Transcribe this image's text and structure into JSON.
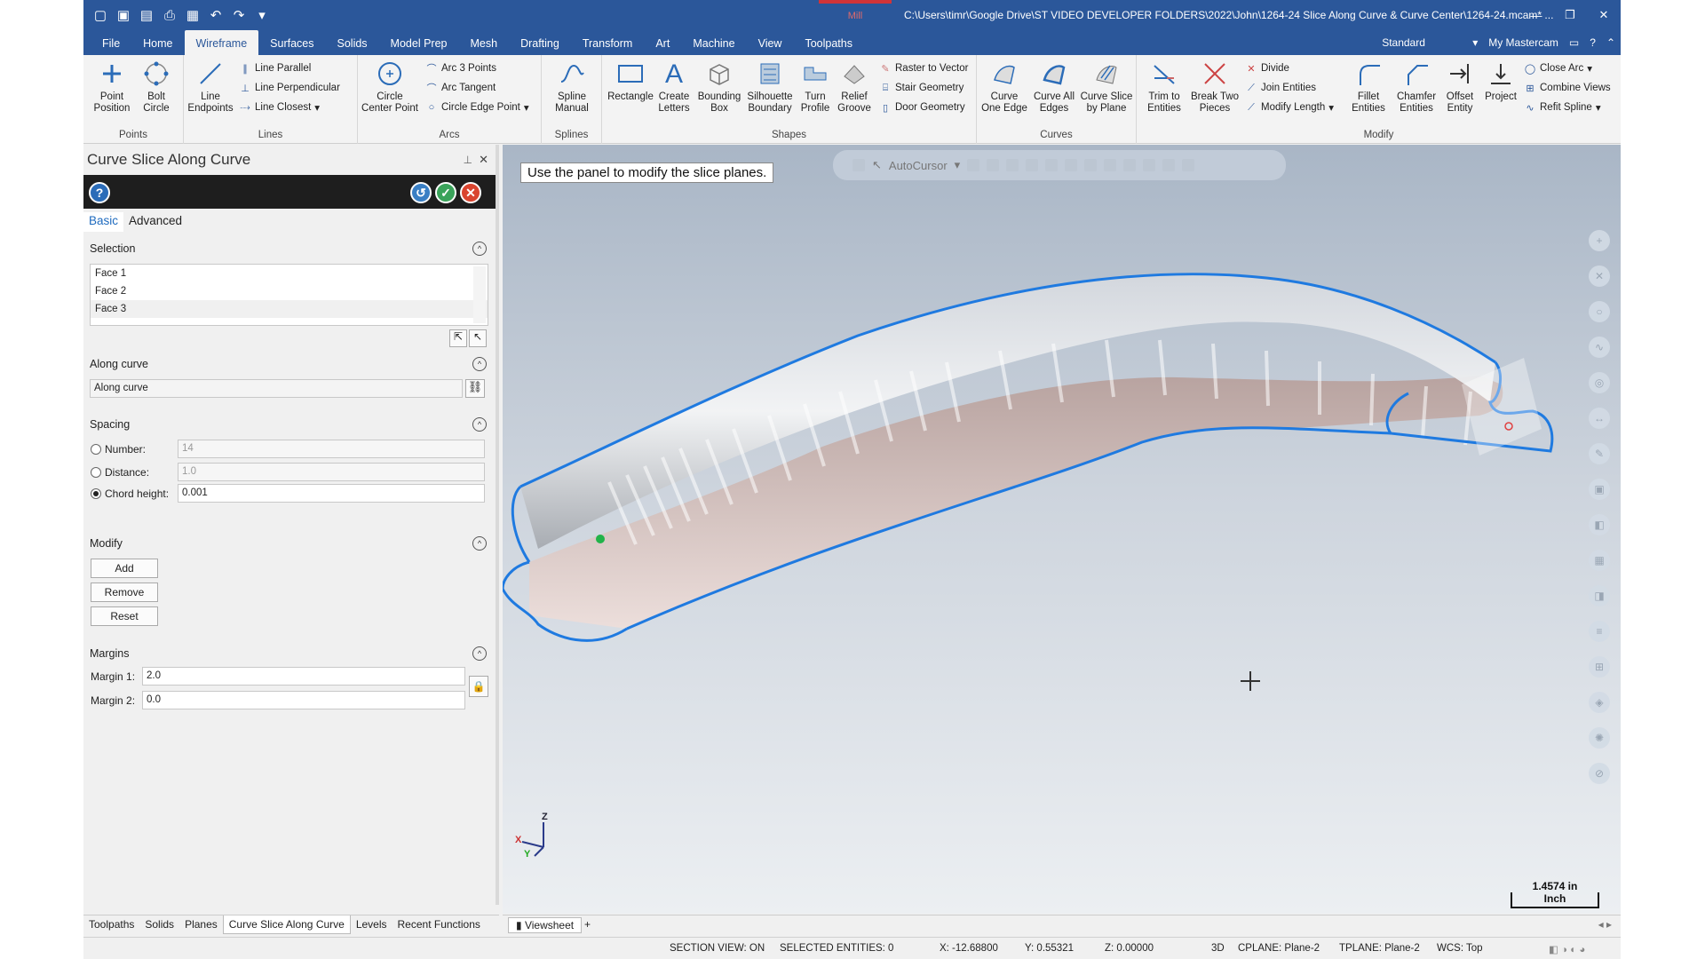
{
  "titlebar": {
    "context_tab": "Mill",
    "title": "C:\\Users\\timr\\Google Drive\\ST VIDEO DEVELOPER FOLDERS\\2022\\John\\1264-24 Slice Along Curve & Curve Center\\1264-24.mcam* ..."
  },
  "tabs": [
    "File",
    "Home",
    "Wireframe",
    "Surfaces",
    "Solids",
    "Model Prep",
    "Mesh",
    "Drafting",
    "Transform",
    "Art",
    "Machine",
    "View",
    "Toolpaths"
  ],
  "active_tab": "Wireframe",
  "workspace": "Standard",
  "account": "My Mastercam",
  "ribbon": {
    "points": {
      "label": "Points",
      "point_position": "Point\nPosition",
      "bolt_circle": "Bolt\nCircle"
    },
    "lines": {
      "label": "Lines",
      "line_endpoints": "Line\nEndpoints",
      "line_parallel": "Line Parallel",
      "line_perpendicular": "Line Perpendicular",
      "line_closest": "Line Closest"
    },
    "arcs": {
      "label": "Arcs",
      "circle_center_point": "Circle\nCenter Point",
      "arc_3_points": "Arc 3 Points",
      "arc_tangent": "Arc Tangent",
      "circle_edge_point": "Circle Edge Point"
    },
    "splines": {
      "label": "Splines",
      "spline_manual": "Spline\nManual"
    },
    "shapes": {
      "label": "Shapes",
      "rectangle": "Rectangle",
      "create_letters": "Create\nLetters",
      "bounding_box": "Bounding\nBox",
      "silhouette_boundary": "Silhouette\nBoundary",
      "turn_profile": "Turn\nProfile",
      "relief_groove": "Relief\nGroove",
      "raster_to_vector": "Raster to Vector",
      "stair_geometry": "Stair Geometry",
      "door_geometry": "Door Geometry"
    },
    "curves": {
      "label": "Curves",
      "curve_one_edge": "Curve\nOne Edge",
      "curve_all_edges": "Curve All\nEdges",
      "curve_slice_by_plane": "Curve Slice\nby Plane"
    },
    "modify": {
      "label": "Modify",
      "trim_to_entities": "Trim to\nEntities",
      "break_two_pieces": "Break Two\nPieces",
      "divide": "Divide",
      "join_entities": "Join Entities",
      "modify_length": "Modify Length",
      "fillet_entities": "Fillet\nEntities",
      "chamfer_entities": "Chamfer\nEntities",
      "offset_entity": "Offset\nEntity",
      "project": "Project",
      "close_arc": "Close Arc",
      "combine_views": "Combine Views",
      "refit_spline": "Refit Spline"
    }
  },
  "panel": {
    "title": "Curve Slice Along Curve",
    "tabs": [
      "Basic",
      "Advanced"
    ],
    "selection": {
      "label": "Selection",
      "items": [
        "Face 1",
        "Face 2",
        "Face 3"
      ]
    },
    "along_curve": {
      "label": "Along curve",
      "value": "Along curve"
    },
    "spacing": {
      "label": "Spacing",
      "number_label": "Number:",
      "number_value": "14",
      "distance_label": "Distance:",
      "distance_value": "1.0",
      "chord_label": "Chord height:",
      "chord_value": "0.001"
    },
    "modify": {
      "label": "Modify",
      "add": "Add",
      "remove": "Remove",
      "reset": "Reset"
    },
    "margins": {
      "label": "Margins",
      "margin1_label": "Margin 1:",
      "margin1_value": "2.0",
      "margin2_label": "Margin 2:",
      "margin2_value": "0.0"
    }
  },
  "bottom_tabs": [
    "Toolpaths",
    "Solids",
    "Planes",
    "Curve Slice Along Curve",
    "Levels",
    "Recent Functions"
  ],
  "bottom_active": "Curve Slice Along Curve",
  "viewport": {
    "prompt": "Use the panel to modify the slice planes.",
    "autocursor": "AutoCursor",
    "scale_value": "1.4574 in",
    "scale_unit": "Inch",
    "axis_x": "X",
    "axis_y": "Y",
    "axis_z": "Z"
  },
  "view_tab": "Viewsheet",
  "status": {
    "section_view": "SECTION VIEW: ON",
    "selected": "SELECTED ENTITIES: 0",
    "x": "X:  -12.68800",
    "y": "Y:  0.55321",
    "z": "Z:  0.00000",
    "mode": "3D",
    "cplane": "CPLANE: Plane-2",
    "tplane": "TPLANE: Plane-2",
    "wcs": "WCS: Top"
  }
}
